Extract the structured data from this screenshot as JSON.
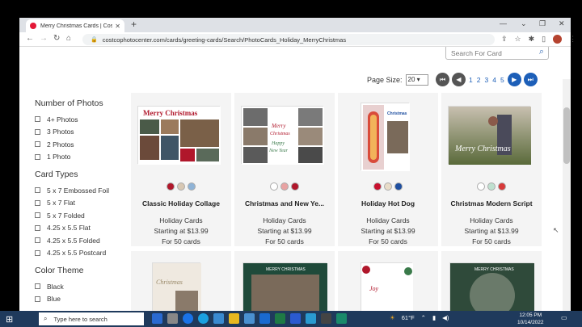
{
  "browser": {
    "tab_title": "Merry Christmas Cards | Costco P",
    "url": "costcophotocenter.com/cards/greeting-cards/Search/PhotoCards_Holiday_MerryChristmas"
  },
  "search": {
    "placeholder": "Search For Card"
  },
  "pagination": {
    "page_size_label": "Page Size:",
    "page_size_value": "20",
    "pages": [
      "1",
      "2",
      "3",
      "4",
      "5"
    ]
  },
  "sidebar": {
    "number_of_photos": {
      "title": "Number of Photos",
      "options": [
        "4+ Photos",
        "3 Photos",
        "2 Photos",
        "1 Photo"
      ]
    },
    "card_types": {
      "title": "Card Types",
      "options": [
        "5 x 7 Embossed Foil",
        "5 x 7 Flat",
        "5 x 7 Folded",
        "4.25 x 5.5 Flat",
        "4.25 x 5.5 Folded",
        "4.25 x 5.5 Postcard"
      ]
    },
    "color_theme": {
      "title": "Color Theme",
      "options": [
        "Black",
        "Blue"
      ]
    }
  },
  "cards": [
    {
      "name": "Classic Holiday Collage",
      "category": "Holiday Cards",
      "price": "Starting at $13.99",
      "qty": "For 50 cards",
      "colors": [
        "#b0172b",
        "#d7c7b3",
        "#8fb3d6"
      ]
    },
    {
      "name": "Christmas and New Ye...",
      "category": "Holiday Cards",
      "price": "Starting at $13.99",
      "qty": "For 50 cards",
      "colors": [
        "#ffffff",
        "#e8a3a3",
        "#b0172b"
      ]
    },
    {
      "name": "Holiday Hot Dog",
      "category": "Holiday Cards",
      "price": "Starting at $13.99",
      "qty": "For 50 cards",
      "colors": [
        "#c8102e",
        "#e8dcc8",
        "#1f4fa0"
      ]
    },
    {
      "name": "Christmas Modern Script",
      "category": "Holiday Cards",
      "price": "Starting at $13.99",
      "qty": "For 50 cards",
      "colors": [
        "#ffffff",
        "#bfe0cf",
        "#d73a3a"
      ]
    }
  ],
  "taskbar": {
    "search_placeholder": "Type here to search",
    "weather": "61°F",
    "time": "12:05 PM",
    "date": "10/14/2022"
  }
}
